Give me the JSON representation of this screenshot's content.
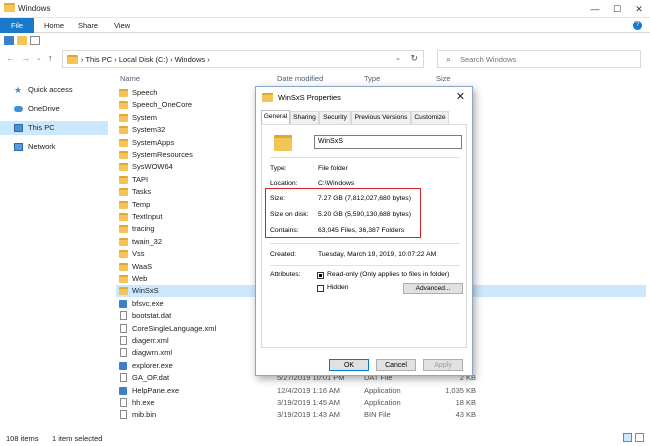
{
  "window": {
    "title": "Windows",
    "minimize": "—",
    "maximize": "☐",
    "close": "✕"
  },
  "ribbon": {
    "tabs": [
      "File",
      "Home",
      "Share",
      "View"
    ],
    "help": "?"
  },
  "address": {
    "path_pc": "This PC",
    "path_disk": "Local Disk (C:)",
    "path_folder": "Windows",
    "sep": "›"
  },
  "search": {
    "placeholder": "Search Windows"
  },
  "navpane": {
    "items": [
      "Quick access",
      "OneDrive",
      "This PC",
      "Network"
    ]
  },
  "columns": {
    "name": "Name",
    "date": "Date modified",
    "type": "Type",
    "size": "Size"
  },
  "files": [
    {
      "name": "Speech",
      "date": "",
      "type": "",
      "size": "",
      "kind": "folder"
    },
    {
      "name": "Speech_OneCore",
      "date": "",
      "type": "",
      "size": "",
      "kind": "folder"
    },
    {
      "name": "System",
      "date": "",
      "type": "",
      "size": "",
      "kind": "folder"
    },
    {
      "name": "System32",
      "date": "",
      "type": "",
      "size": "",
      "kind": "folder"
    },
    {
      "name": "SystemApps",
      "date": "",
      "type": "",
      "size": "",
      "kind": "folder"
    },
    {
      "name": "SystemResources",
      "date": "",
      "type": "",
      "size": "",
      "kind": "folder"
    },
    {
      "name": "SysWOW64",
      "date": "",
      "type": "",
      "size": "",
      "kind": "folder"
    },
    {
      "name": "TAPI",
      "date": "",
      "type": "",
      "size": "",
      "kind": "folder"
    },
    {
      "name": "Tasks",
      "date": "",
      "type": "",
      "size": "",
      "kind": "folder"
    },
    {
      "name": "Temp",
      "date": "",
      "type": "",
      "size": "",
      "kind": "folder"
    },
    {
      "name": "TextInput",
      "date": "",
      "type": "",
      "size": "",
      "kind": "folder"
    },
    {
      "name": "tracing",
      "date": "",
      "type": "",
      "size": "",
      "kind": "folder"
    },
    {
      "name": "twain_32",
      "date": "",
      "type": "",
      "size": "",
      "kind": "folder"
    },
    {
      "name": "Vss",
      "date": "",
      "type": "",
      "size": "",
      "kind": "folder"
    },
    {
      "name": "WaaS",
      "date": "",
      "type": "",
      "size": "",
      "kind": "folder"
    },
    {
      "name": "Web",
      "date": "",
      "type": "",
      "size": "",
      "kind": "folder"
    },
    {
      "name": "WinSxS",
      "date": "",
      "type": "",
      "size": "",
      "kind": "folder",
      "selected": true
    },
    {
      "name": "bfsvc.exe",
      "date": "",
      "type": "",
      "size": "",
      "kind": "exe"
    },
    {
      "name": "bootstat.dat",
      "date": "",
      "type": "",
      "size": "",
      "kind": "file"
    },
    {
      "name": "CoreSingleLanguage.xml",
      "date": "",
      "type": "",
      "size": "",
      "kind": "file"
    },
    {
      "name": "diagerr.xml",
      "date": "",
      "type": "",
      "size": "",
      "kind": "file"
    },
    {
      "name": "diagwrn.xml",
      "date": "",
      "type": "",
      "size": "",
      "kind": "file"
    },
    {
      "name": "explorer.exe",
      "date": "",
      "type": "",
      "size": "",
      "kind": "exe"
    },
    {
      "name": "GA_OF.dat",
      "date": "5/27/2019 10:01 PM",
      "type": "DAT File",
      "size": "2 KB",
      "kind": "file"
    },
    {
      "name": "HelpPane.exe",
      "date": "12/4/2019 1:16 AM",
      "type": "Application",
      "size": "1,035 KB",
      "kind": "exe"
    },
    {
      "name": "hh.exe",
      "date": "3/19/2019 1:45 AM",
      "type": "Application",
      "size": "18 KB",
      "kind": "file"
    },
    {
      "name": "mib.bin",
      "date": "3/19/2019 1:43 AM",
      "type": "BIN File",
      "size": "43 KB",
      "kind": "file"
    }
  ],
  "status": {
    "count": "108 items",
    "selected": "1 item selected"
  },
  "dialog": {
    "title": "WinSxS Properties",
    "close": "✕",
    "tabs": [
      "General",
      "Sharing",
      "Security",
      "Previous Versions",
      "Customize"
    ],
    "name": "WinSxS",
    "type_label": "Type:",
    "type_value": "File folder",
    "location_label": "Location:",
    "location_value": "C:\\Windows",
    "size_label": "Size:",
    "size_value": "7.27 GB (7,812,027,680 bytes)",
    "disk_label": "Size on disk:",
    "disk_value": "5.20 GB (5,590,130,688 bytes)",
    "contains_label": "Contains:",
    "contains_value": "63,045 Files, 36,387 Folders",
    "created_label": "Created:",
    "created_value": "Tuesday, March 19, 2019, 10:07:22 AM",
    "attributes_label": "Attributes:",
    "readonly_label": "Read-only (Only applies to files in folder)",
    "hidden_label": "Hidden",
    "advanced_label": "Advanced...",
    "ok": "OK",
    "cancel": "Cancel",
    "apply": "Apply"
  }
}
